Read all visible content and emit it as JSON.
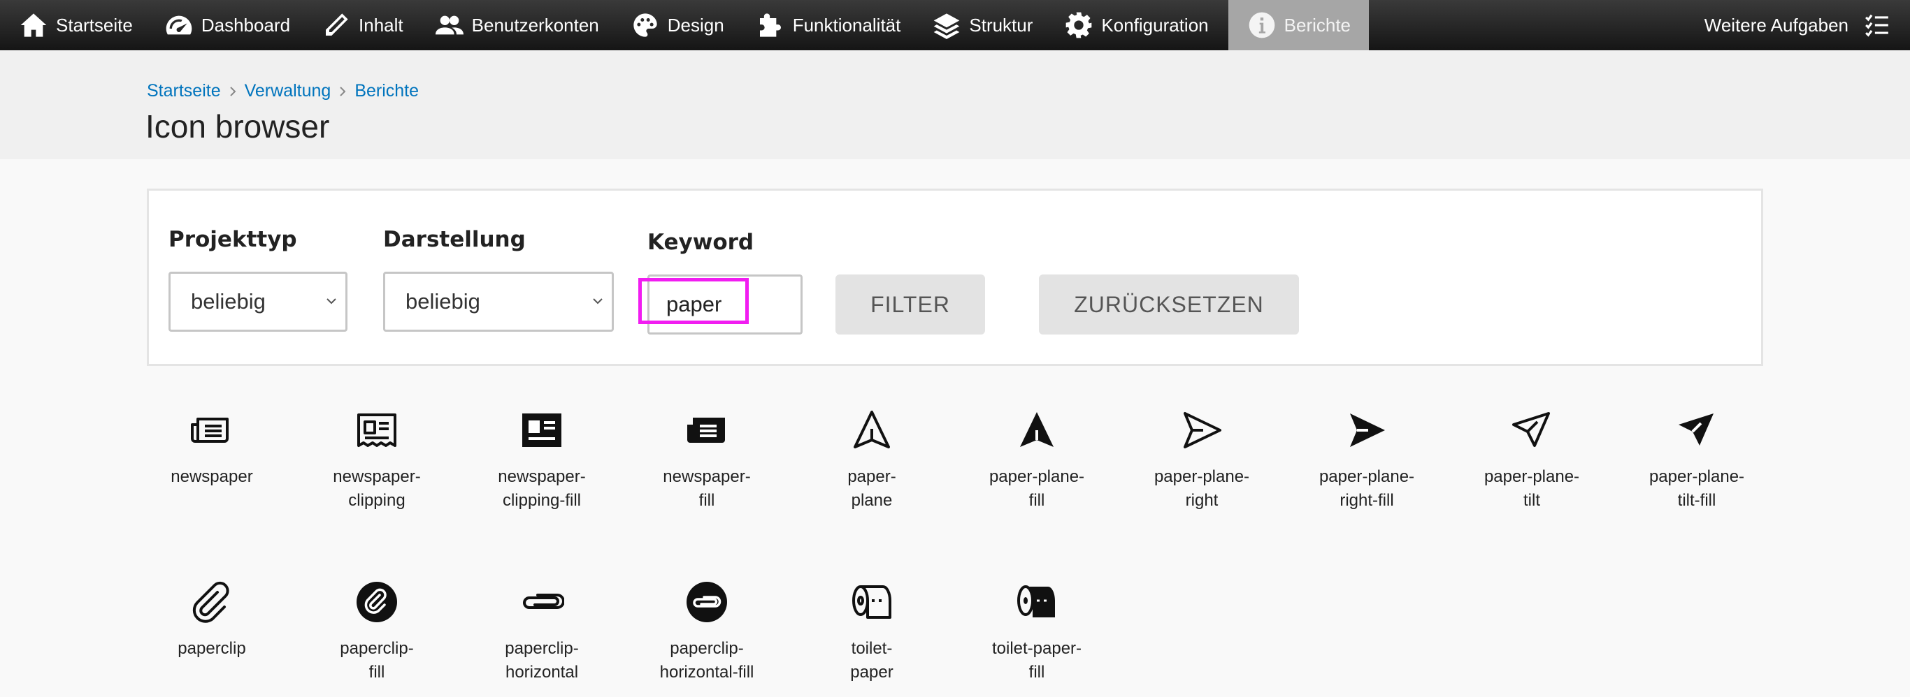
{
  "toolbar": {
    "items": [
      {
        "label": "Startseite",
        "icon": "home-icon"
      },
      {
        "label": "Dashboard",
        "icon": "dashboard-gauge-icon"
      },
      {
        "label": "Inhalt",
        "icon": "pencil-icon"
      },
      {
        "label": "Benutzerkonten",
        "icon": "users-icon"
      },
      {
        "label": "Design",
        "icon": "palette-icon"
      },
      {
        "label": "Funktionalität",
        "icon": "puzzle-icon"
      },
      {
        "label": "Struktur",
        "icon": "layers-icon"
      },
      {
        "label": "Konfiguration",
        "icon": "gear-icon"
      },
      {
        "label": "Berichte",
        "icon": "info-icon"
      }
    ],
    "more_label": "Weitere Aufgaben",
    "active": "Berichte"
  },
  "breadcrumb": [
    "Startseite",
    "Verwaltung",
    "Berichte"
  ],
  "page_title": "Icon browser",
  "filter": {
    "projekttyp_label": "Projekttyp",
    "projekttyp_value": "beliebig",
    "darstellung_label": "Darstellung",
    "darstellung_value": "beliebig",
    "keyword_label": "Keyword",
    "keyword_value": "paper",
    "filter_button": "FILTER",
    "reset_button": "ZURÜCKSETZEN"
  },
  "colors": {
    "link": "#0074bd",
    "highlight": "#f11df1",
    "toolbar_active": "#a6a6a6"
  },
  "icons": [
    {
      "label": "newspaper",
      "icon": "newspaper-icon"
    },
    {
      "label": "newspaper-clipping",
      "icon": "newspaper-clipping-icon"
    },
    {
      "label": "newspaper-clipping-fill",
      "icon": "newspaper-clipping-fill-icon"
    },
    {
      "label": "newspaper-fill",
      "icon": "newspaper-fill-icon"
    },
    {
      "label": "paper-plane",
      "icon": "paper-plane-icon"
    },
    {
      "label": "paper-plane-fill",
      "icon": "paper-plane-fill-icon"
    },
    {
      "label": "paper-plane-right",
      "icon": "paper-plane-right-icon"
    },
    {
      "label": "paper-plane-right-fill",
      "icon": "paper-plane-right-fill-icon"
    },
    {
      "label": "paper-plane-tilt",
      "icon": "paper-plane-tilt-icon"
    },
    {
      "label": "paper-plane-tilt-fill",
      "icon": "paper-plane-tilt-fill-icon"
    },
    {
      "label": "paperclip",
      "icon": "paperclip-icon"
    },
    {
      "label": "paperclip-fill",
      "icon": "paperclip-fill-icon"
    },
    {
      "label": "paperclip-horizontal",
      "icon": "paperclip-horizontal-icon"
    },
    {
      "label": "paperclip-horizontal-fill",
      "icon": "paperclip-horizontal-fill-icon"
    },
    {
      "label": "toilet-paper",
      "icon": "toilet-paper-icon"
    },
    {
      "label": "toilet-paper-fill",
      "icon": "toilet-paper-fill-icon"
    }
  ]
}
